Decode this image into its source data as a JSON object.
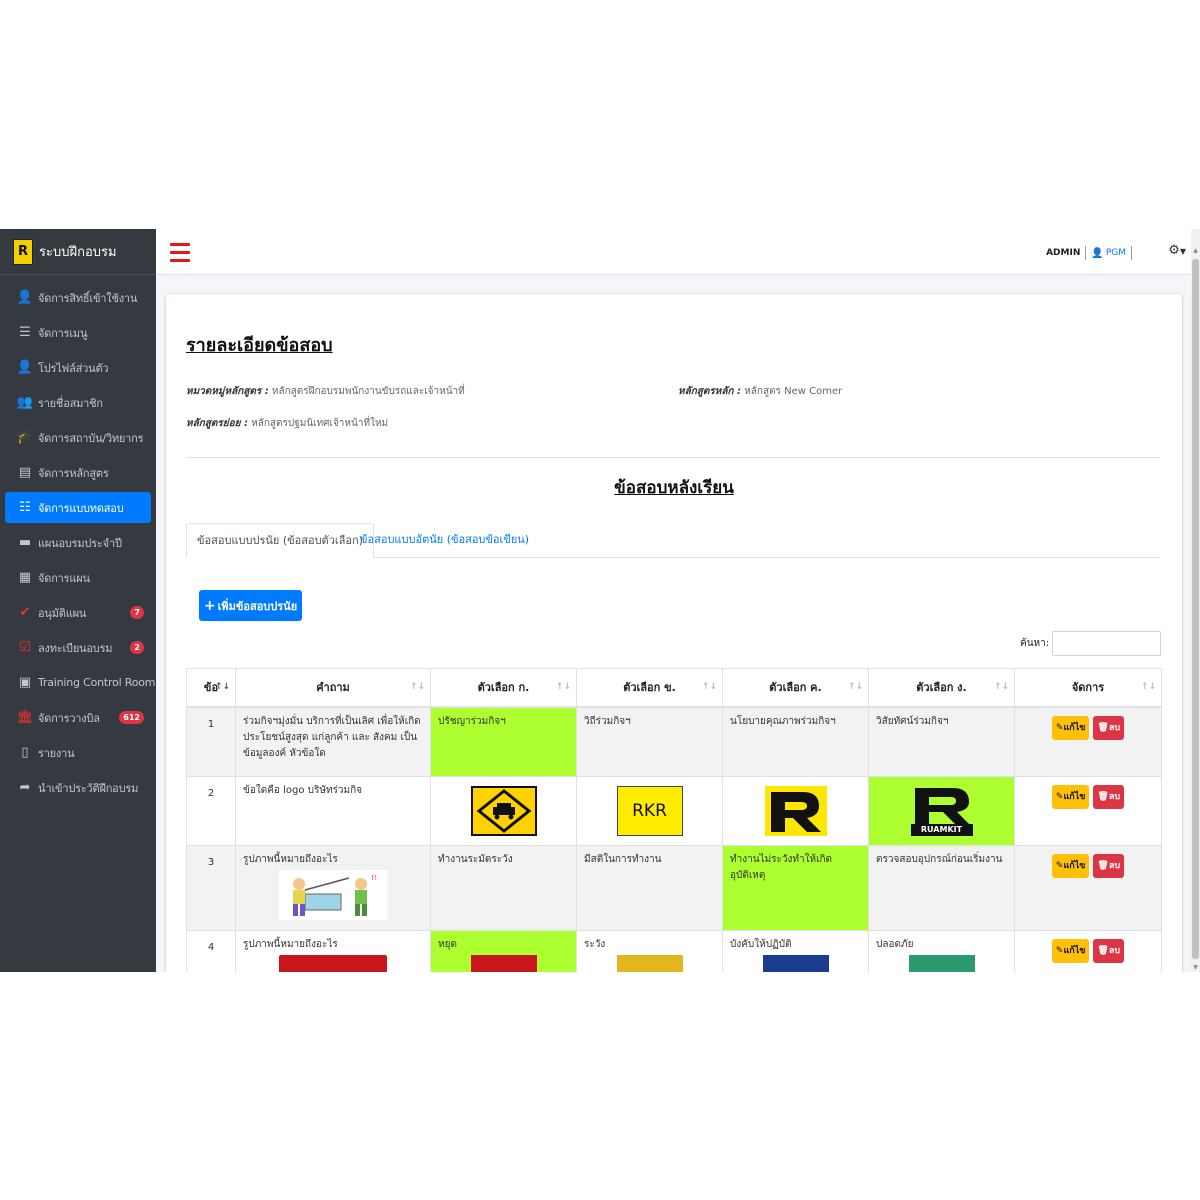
{
  "sidebar": {
    "brand": "ระบบฝึกอบรม",
    "logo_letter": "R",
    "items": [
      {
        "label": "จัดการสิทธิ์เข้าใช้งาน",
        "icon": "user-lock-icon",
        "glyph": "👤"
      },
      {
        "label": "จัดการเมนู",
        "icon": "list-icon",
        "glyph": "☰"
      },
      {
        "label": "โปรไฟล์ส่วนตัว",
        "icon": "user-icon",
        "glyph": "👤"
      },
      {
        "label": "รายชื่อสมาชิก",
        "icon": "users-icon",
        "glyph": "👥"
      },
      {
        "label": "จัดการสถาบัน/วิทยากร",
        "icon": "graduation-cap-icon",
        "glyph": "🎓"
      },
      {
        "label": "จัดการหลักสูตร",
        "icon": "book-icon",
        "glyph": "▤"
      },
      {
        "label": "จัดการแบบทดสอบ",
        "icon": "list-ol-icon",
        "glyph": "☷"
      },
      {
        "label": "แผนอบรมประจำปี",
        "icon": "folder-icon",
        "glyph": "▬"
      },
      {
        "label": "จัดการแผน",
        "icon": "grid-icon",
        "glyph": "▦"
      },
      {
        "label": "อนุมัติแผน",
        "icon": "check-icon",
        "glyph": "✔",
        "badge": "7"
      },
      {
        "label": "ลงทะเบียนอบรม",
        "icon": "check-square-icon",
        "glyph": "☑",
        "badge": "2"
      },
      {
        "label": "Training Control Room",
        "icon": "id-card-icon",
        "glyph": "▣"
      },
      {
        "label": "จัดการวางบิล",
        "icon": "university-icon",
        "glyph": "🏛",
        "badge": "612"
      },
      {
        "label": "รายงาน",
        "icon": "file-icon",
        "glyph": "▯"
      },
      {
        "label": "นำเข้าประวัติฝึกอบรม",
        "icon": "share-icon",
        "glyph": "➦"
      }
    ]
  },
  "topbar": {
    "admin": "ADMIN",
    "user": "PGM",
    "settings_icon": "gear-icon"
  },
  "page": {
    "title": "รายละเอียดข้อสอบ",
    "category_label": "หมวดหมู่หลักสูตร :",
    "category_value": "หลักสูตรฝึกอบรมพนักงานขับรถและเจ้าหน้าที่",
    "main_course_label": "หลักสูตรหลัก :",
    "main_course_value": "หลักสูตร New Comer",
    "sub_course_label": "หลักสูตรย่อย :",
    "sub_course_value": "หลักสูตรปฐมนิเทศเจ้าหน้าที่ใหม่",
    "section_title": "ข้อสอบหลังเรียน",
    "tabs": [
      {
        "label": "ข้อสอบแบบปรนัย (ข้อสอบตัวเลือก)"
      },
      {
        "label": "ข้อสอบแบบอัตนัย (ข้อสอบข้อเขียน)"
      }
    ],
    "add_button": "เพิ่มข้อสอบปรนัย",
    "search_label": "ค้นหา:"
  },
  "table": {
    "headers": [
      "ข้อ",
      "คำถาม",
      "ตัวเลือก ก.",
      "ตัวเลือก ข.",
      "ตัวเลือก ค.",
      "ตัวเลือก ง.",
      "จัดการ"
    ],
    "edit_label": "แก้ไข",
    "delete_label": "ลบ",
    "correct_color": "#adff2f",
    "rows": [
      {
        "no": "1",
        "question": "ร่วมกิจฯมุ่งมั่น บริการที่เป็นเลิศ เพื่อให้เกิดประโยชน์สูงสุด แก่ลูกค้า และ สังคม เป็นข้อมูลองค์ หัวข้อใด",
        "a": "ปรัชญาร่วมกิจฯ",
        "b": "วิถีร่วมกิจฯ",
        "c": "นโยบายคุณภาพร่วมกิจฯ",
        "d": "วิสัยทัศน์ร่วมกิจฯ",
        "correct": "a"
      },
      {
        "no": "2",
        "question": "ข้อใดคือ logo บริษัทร่วมกิจ",
        "b_text": "RKR",
        "d_text": "RUAMKIT",
        "correct": "d"
      },
      {
        "no": "3",
        "question": "รูปภาพนี้หมายถึงอะไร",
        "a": "ทำงานระมัดระวัง",
        "b": "มีสติในการทำงาน",
        "c": "ทำงานไม่ระวังทำให้เกิดอุบัติเหตุ",
        "d": "ตรวจสอบอุปกรณ์ก่อนเริ่มงาน",
        "correct": "c"
      },
      {
        "no": "4",
        "question": "รูปภาพนี้หมายถึงอะไร",
        "a": "หยุด",
        "b": "ระวัง",
        "c": "บังคับให้ปฏิบัติ",
        "d": "ปลอดภัย",
        "correct": "a"
      }
    ]
  }
}
